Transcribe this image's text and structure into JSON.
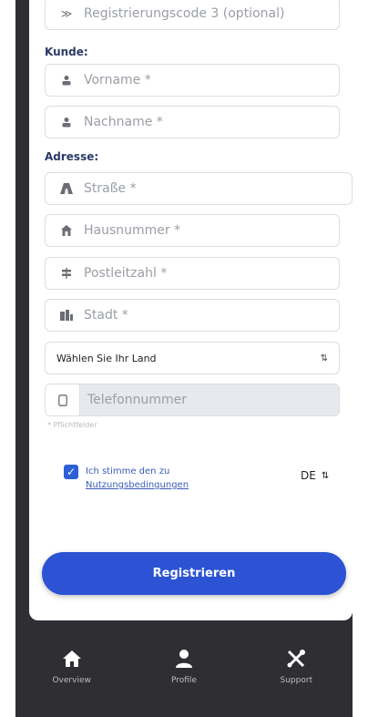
{
  "form": {
    "registration_code_3": {
      "placeholder": "Registrierungscode 3 (optional)"
    },
    "customer_label": "Kunde:",
    "first_name": {
      "placeholder": "Vorname *"
    },
    "last_name": {
      "placeholder": "Nachname *"
    },
    "address_label": "Adresse:",
    "street": {
      "placeholder": "Straße *"
    },
    "house_number": {
      "placeholder": "Hausnummer *"
    },
    "postal_code": {
      "placeholder": "Postleitzahl *"
    },
    "city": {
      "placeholder": "Stadt *"
    },
    "country_select": {
      "value": "Wählen Sie Ihr Land"
    },
    "phone": {
      "placeholder": "Telefonnummer"
    },
    "required_hint": "* Pflichtfelder",
    "terms": {
      "checked": true,
      "text": "Ich stimme den zu",
      "link": "Nutzungsbedingungen"
    },
    "language": "DE",
    "submit_label": "Registrieren"
  },
  "bottom_nav": {
    "items": [
      {
        "label": "Overview",
        "icon": "home-icon"
      },
      {
        "label": "Profile",
        "icon": "person-icon"
      },
      {
        "label": "Support",
        "icon": "tools-icon"
      }
    ]
  },
  "colors": {
    "primary": "#2b53d4",
    "section_label": "#2b3a67",
    "nav_background": "#2f2f33"
  }
}
